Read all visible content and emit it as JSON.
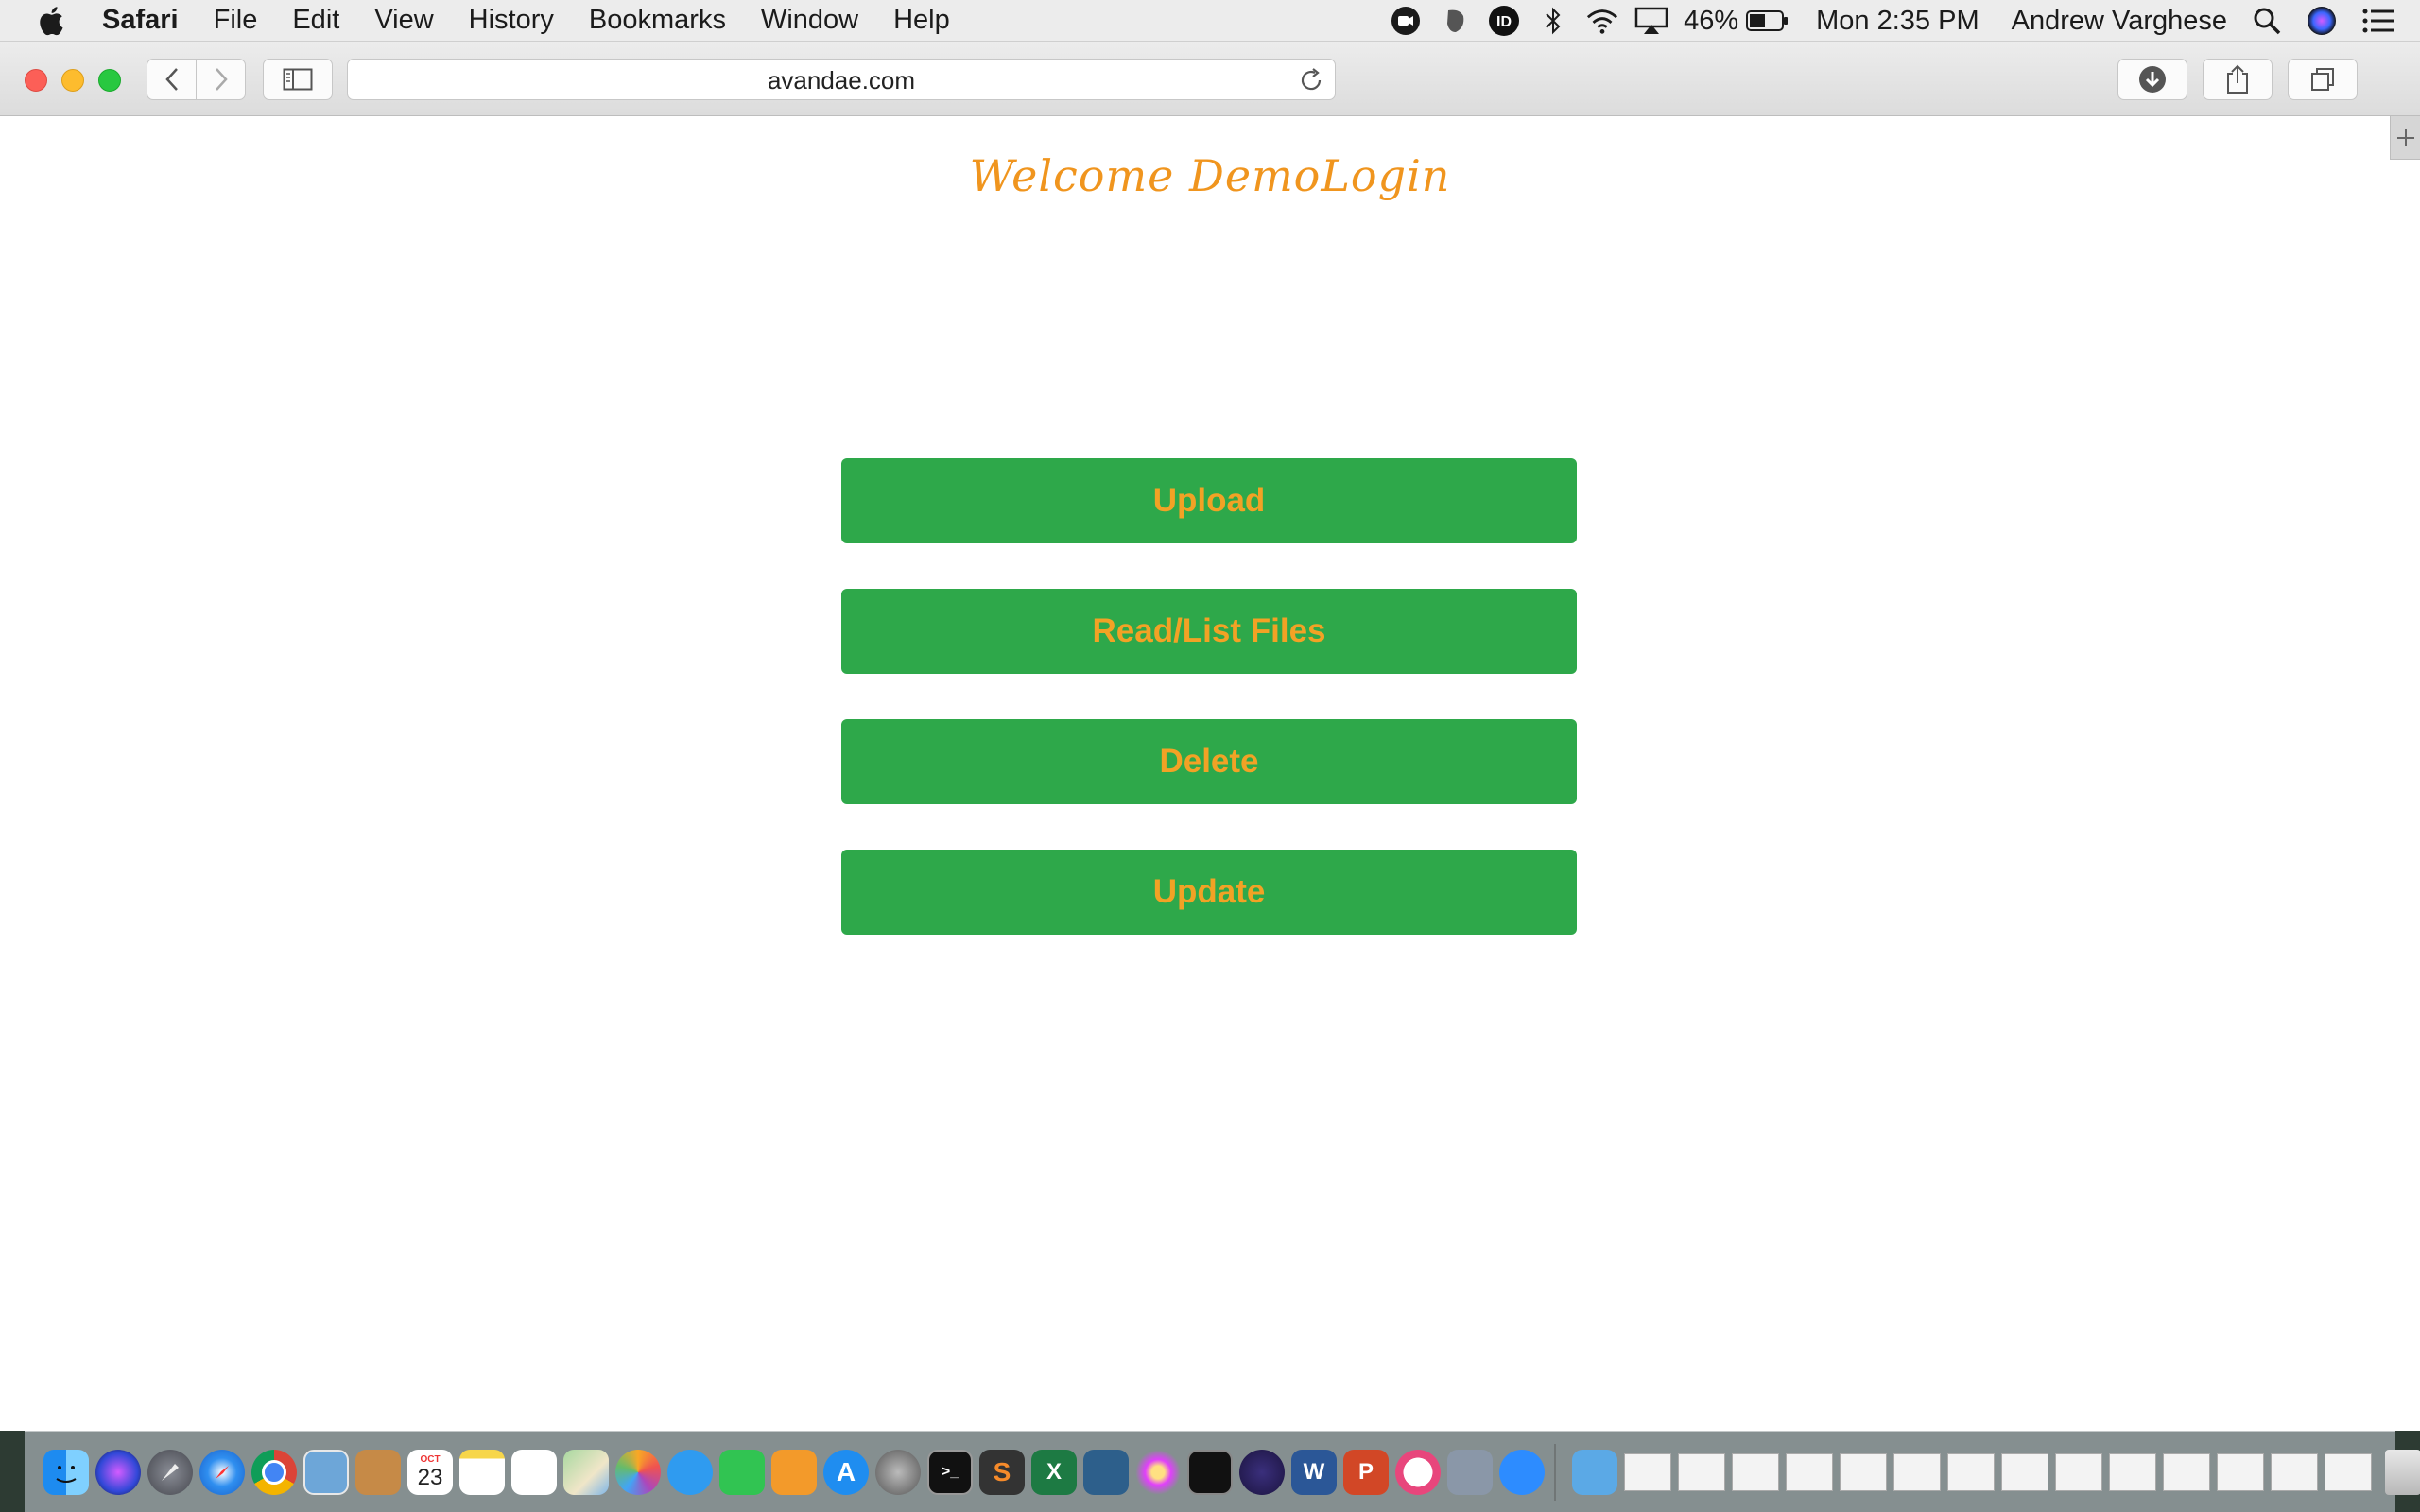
{
  "menubar": {
    "app_name": "Safari",
    "items": [
      "File",
      "Edit",
      "View",
      "History",
      "Bookmarks",
      "Window",
      "Help"
    ],
    "battery_percent": "46%",
    "clock": "Mon 2:35 PM",
    "user_name": "Andrew Varghese"
  },
  "browser": {
    "url": "avandae.com"
  },
  "page": {
    "welcome_text": "Welcome DemoLogin",
    "buttons": {
      "upload": "Upload",
      "read_list": "Read/List Files",
      "delete": "Delete",
      "update": "Update"
    },
    "colors": {
      "button_bg": "#2ea84a",
      "button_text": "#f2a225",
      "welcome_text": "#f0951e"
    }
  },
  "dock": {
    "calendar_month": "OCT",
    "calendar_day": "23",
    "apps": [
      "finder",
      "siri",
      "launchpad",
      "safari",
      "chrome",
      "preview",
      "contacts",
      "calendar",
      "notes",
      "reminders",
      "maps",
      "photos",
      "messages",
      "facetime",
      "pages",
      "app-store",
      "system-preferences",
      "terminal",
      "sublime",
      "excel",
      "mysql-workbench",
      "flower-app",
      "activity-monitor",
      "eclipse",
      "word",
      "powerpoint",
      "itunes",
      "image-capture",
      "zoom",
      "downloads-folder",
      "trash"
    ]
  }
}
